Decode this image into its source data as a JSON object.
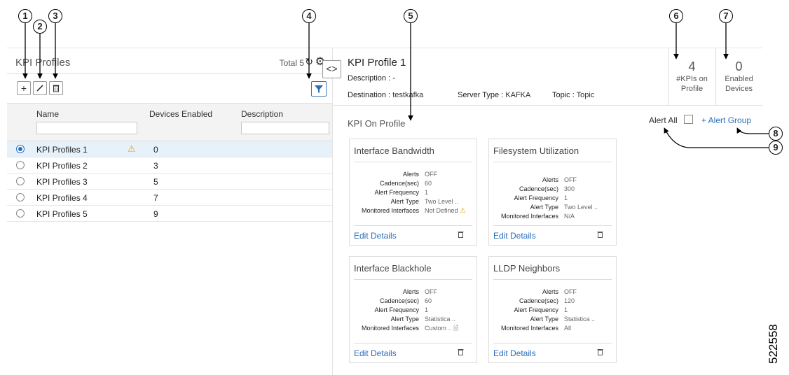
{
  "callouts": [
    "1",
    "2",
    "3",
    "4",
    "5",
    "6",
    "7",
    "8",
    "9"
  ],
  "left_panel": {
    "title": "KPI Profiles",
    "total": "Total 5",
    "columns": [
      "Name",
      "Devices Enabled",
      "Description"
    ],
    "rows": [
      {
        "name": "KPI Profiles 1",
        "devices": "0",
        "selected": true,
        "warning": true
      },
      {
        "name": "KPI Profiles 2",
        "devices": "3",
        "selected": false,
        "warning": false
      },
      {
        "name": "KPI Profiles 3",
        "devices": "5",
        "selected": false,
        "warning": false
      },
      {
        "name": "KPI Profiles 4",
        "devices": "7",
        "selected": false,
        "warning": false
      },
      {
        "name": "KPI Profiles 5",
        "devices": "9",
        "selected": false,
        "warning": false
      }
    ]
  },
  "detail": {
    "title": "KPI Profile 1",
    "description": "Description : -",
    "destination_label": "Destination :",
    "destination_value": "testkafka",
    "server_type_label": "Server Type :",
    "server_type_value": "KAFKA",
    "topic_label": "Topic :",
    "topic_value": "Topic",
    "kpis_count": "4",
    "kpis_label_1": "#KPIs on",
    "kpis_label_2": "Profile",
    "devices_count": "0",
    "devices_label_1": "Enabled",
    "devices_label_2": "Devices",
    "section_title": "KPI On Profile",
    "alert_all": "Alert All",
    "alert_group": "+ Alert Group"
  },
  "field_labels": [
    "Alerts",
    "Cadence(sec)",
    "Alert Frequency",
    "Alert Type",
    "Monitored Interfaces"
  ],
  "edit_label": "Edit Details",
  "cards": [
    {
      "title": "Interface Bandwidth",
      "values": [
        "OFF",
        "60",
        "1",
        "Two Level ..",
        "Not Defined"
      ]
    },
    {
      "title": "Filesystem Utilization",
      "values": [
        "OFF",
        "300",
        "1",
        "Two Level ..",
        "N/A"
      ]
    },
    {
      "title": "Interface Blackhole",
      "values": [
        "OFF",
        "60",
        "1",
        "Statistica ..",
        "Custom .."
      ]
    },
    {
      "title": "LLDP Neighbors",
      "values": [
        "OFF",
        "120",
        "1",
        "Statistica ..",
        "All"
      ]
    }
  ],
  "figure_number": "522558",
  "colors": {
    "accent": "#2a6ebb",
    "warning": "#e8a500",
    "selected_row": "#e6f1fa"
  },
  "icons": [
    "add-icon",
    "edit-icon",
    "delete-icon",
    "refresh-icon",
    "gear-icon",
    "filter-icon",
    "expand-collapse-icon",
    "warning-icon",
    "trash-icon",
    "document-icon"
  ]
}
